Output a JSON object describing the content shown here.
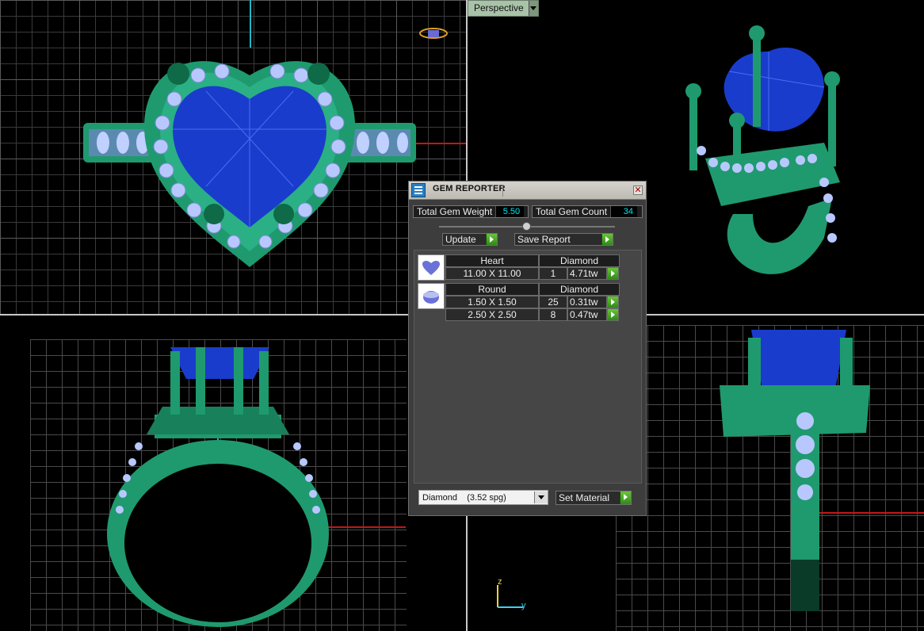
{
  "viewport": {
    "perspective_label": "Perspective"
  },
  "gizmo": {
    "z_label": "z",
    "y_label": "y"
  },
  "gem_reporter": {
    "title": "GEM REPORTER",
    "close_glyph": "✕",
    "total_weight_label": "Total Gem Weight",
    "total_weight_value": "5.50",
    "total_count_label": "Total Gem Count",
    "total_count_value": "34",
    "update_label": "Update",
    "save_report_label": "Save Report",
    "gems": [
      {
        "shape": "Heart",
        "material": "Diamond",
        "rows": [
          {
            "size": "11.00 X 11.00",
            "count": "1",
            "weight": "4.71tw"
          }
        ]
      },
      {
        "shape": "Round",
        "material": "Diamond",
        "rows": [
          {
            "size": "1.50 X 1.50",
            "count": "25",
            "weight": "0.31tw"
          },
          {
            "size": "2.50 X 2.50",
            "count": "8",
            "weight": "0.47tw"
          }
        ]
      }
    ],
    "material_select_value": "Diamond    (3.52 spg)",
    "set_material_label": "Set Material"
  },
  "colors": {
    "metal": "#1f9a6e",
    "gem_blue": "#1a3ccc",
    "diamond": "#b8c8ff",
    "axis_red": "#c01818",
    "axis_cyan": "#1fb8c8"
  }
}
